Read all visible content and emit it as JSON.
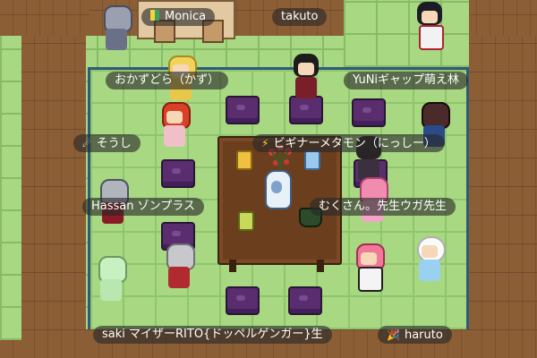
{
  "labels": {
    "monica": "Monica",
    "takuto": "takuto",
    "okazudora": "おかずどら（かず）",
    "yuni": "YuNiギャップ萌え林",
    "soushi": "そうし",
    "beginner": "ビギナーメタモン（にっしー）",
    "hassan": "Hassan ゾンプラス",
    "mukusan": "むくさん。先生ウガ先生",
    "bottom_left": "saki マイザーRITO{ドッペルゲンガー}生",
    "haruto": "haruto"
  },
  "icons": {
    "monica": "beginner-badge-icon",
    "soushi": "comet-icon",
    "beginner": "lightning-icon",
    "haruto": "party-popper-icon"
  }
}
